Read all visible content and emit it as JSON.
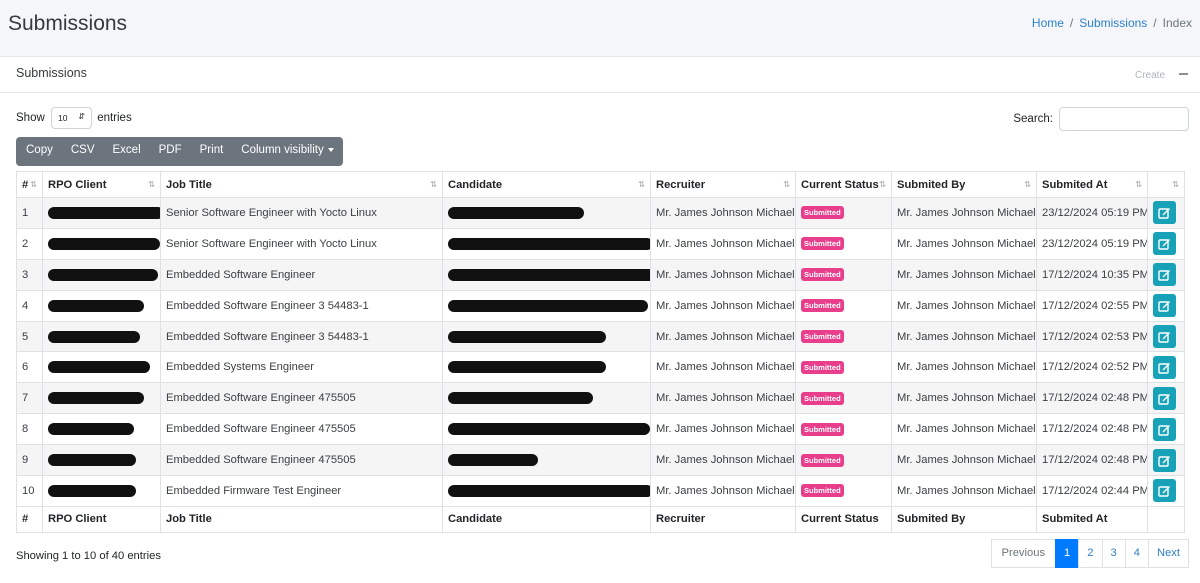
{
  "page": {
    "title": "Submissions"
  },
  "breadcrumb": {
    "home": "Home",
    "submissions": "Submissions",
    "current": "Index",
    "separator": "/"
  },
  "card": {
    "title": "Submissions",
    "create_label": "Create"
  },
  "length": {
    "show": "Show",
    "value": "10",
    "entries": "entries"
  },
  "search": {
    "label": "Search:",
    "value": ""
  },
  "buttons": {
    "copy": "Copy",
    "csv": "CSV",
    "excel": "Excel",
    "pdf": "PDF",
    "print": "Print",
    "colvis": "Column visibility"
  },
  "columns": {
    "num": "#",
    "client": "RPO Client",
    "job": "Job Title",
    "candidate": "Candidate",
    "recruiter": "Recruiter",
    "status": "Current Status",
    "by": "Submited By",
    "at": "Submited At"
  },
  "rows": [
    {
      "num": "1",
      "job": "Senior Software Engineer with Yocto Linux",
      "recruiter": "Mr. James Johnson Michael",
      "status": "Submitted",
      "by": "Mr. James Johnson Michael",
      "at": "23/12/2024 05:19 PM"
    },
    {
      "num": "2",
      "job": "Senior Software Engineer with Yocto Linux",
      "recruiter": "Mr. James Johnson Michael",
      "status": "Submitted",
      "by": "Mr. James Johnson Michael",
      "at": "23/12/2024 05:19 PM"
    },
    {
      "num": "3",
      "job": "Embedded Software Engineer",
      "recruiter": "Mr. James Johnson Michael",
      "status": "Submitted",
      "by": "Mr. James Johnson Michael",
      "at": "17/12/2024 10:35 PM"
    },
    {
      "num": "4",
      "job": "Embedded Software Engineer 3 54483-1",
      "recruiter": "Mr. James Johnson Michael",
      "status": "Submitted",
      "by": "Mr. James Johnson Michael",
      "at": "17/12/2024 02:55 PM"
    },
    {
      "num": "5",
      "job": "Embedded Software Engineer 3 54483-1",
      "recruiter": "Mr. James Johnson Michael",
      "status": "Submitted",
      "by": "Mr. James Johnson Michael",
      "at": "17/12/2024 02:53 PM"
    },
    {
      "num": "6",
      "job": "Embedded Systems Engineer",
      "recruiter": "Mr. James Johnson Michael",
      "status": "Submitted",
      "by": "Mr. James Johnson Michael",
      "at": "17/12/2024 02:52 PM"
    },
    {
      "num": "7",
      "job": "Embedded Software Engineer 475505",
      "recruiter": "Mr. James Johnson Michael",
      "status": "Submitted",
      "by": "Mr. James Johnson Michael",
      "at": "17/12/2024 02:48 PM"
    },
    {
      "num": "8",
      "job": "Embedded Software Engineer 475505",
      "recruiter": "Mr. James Johnson Michael",
      "status": "Submitted",
      "by": "Mr. James Johnson Michael",
      "at": "17/12/2024 02:48 PM"
    },
    {
      "num": "9",
      "job": "Embedded Software Engineer 475505",
      "recruiter": "Mr. James Johnson Michael",
      "status": "Submitted",
      "by": "Mr. James Johnson Michael",
      "at": "17/12/2024 02:48 PM"
    },
    {
      "num": "10",
      "job": "Embedded Firmware Test Engineer",
      "recruiter": "Mr. James Johnson Michael",
      "status": "Submitted",
      "by": "Mr. James Johnson Michael",
      "at": "17/12/2024 02:44 PM"
    }
  ],
  "info": "Showing 1 to 10 of 40 entries",
  "pagination": {
    "previous": "Previous",
    "pages": [
      "1",
      "2",
      "3",
      "4"
    ],
    "next": "Next",
    "active": "1"
  },
  "colors": {
    "badge": "#e83e8c",
    "edit": "#17a2b8",
    "link": "#2f80c9",
    "active_page": "#007bff"
  }
}
